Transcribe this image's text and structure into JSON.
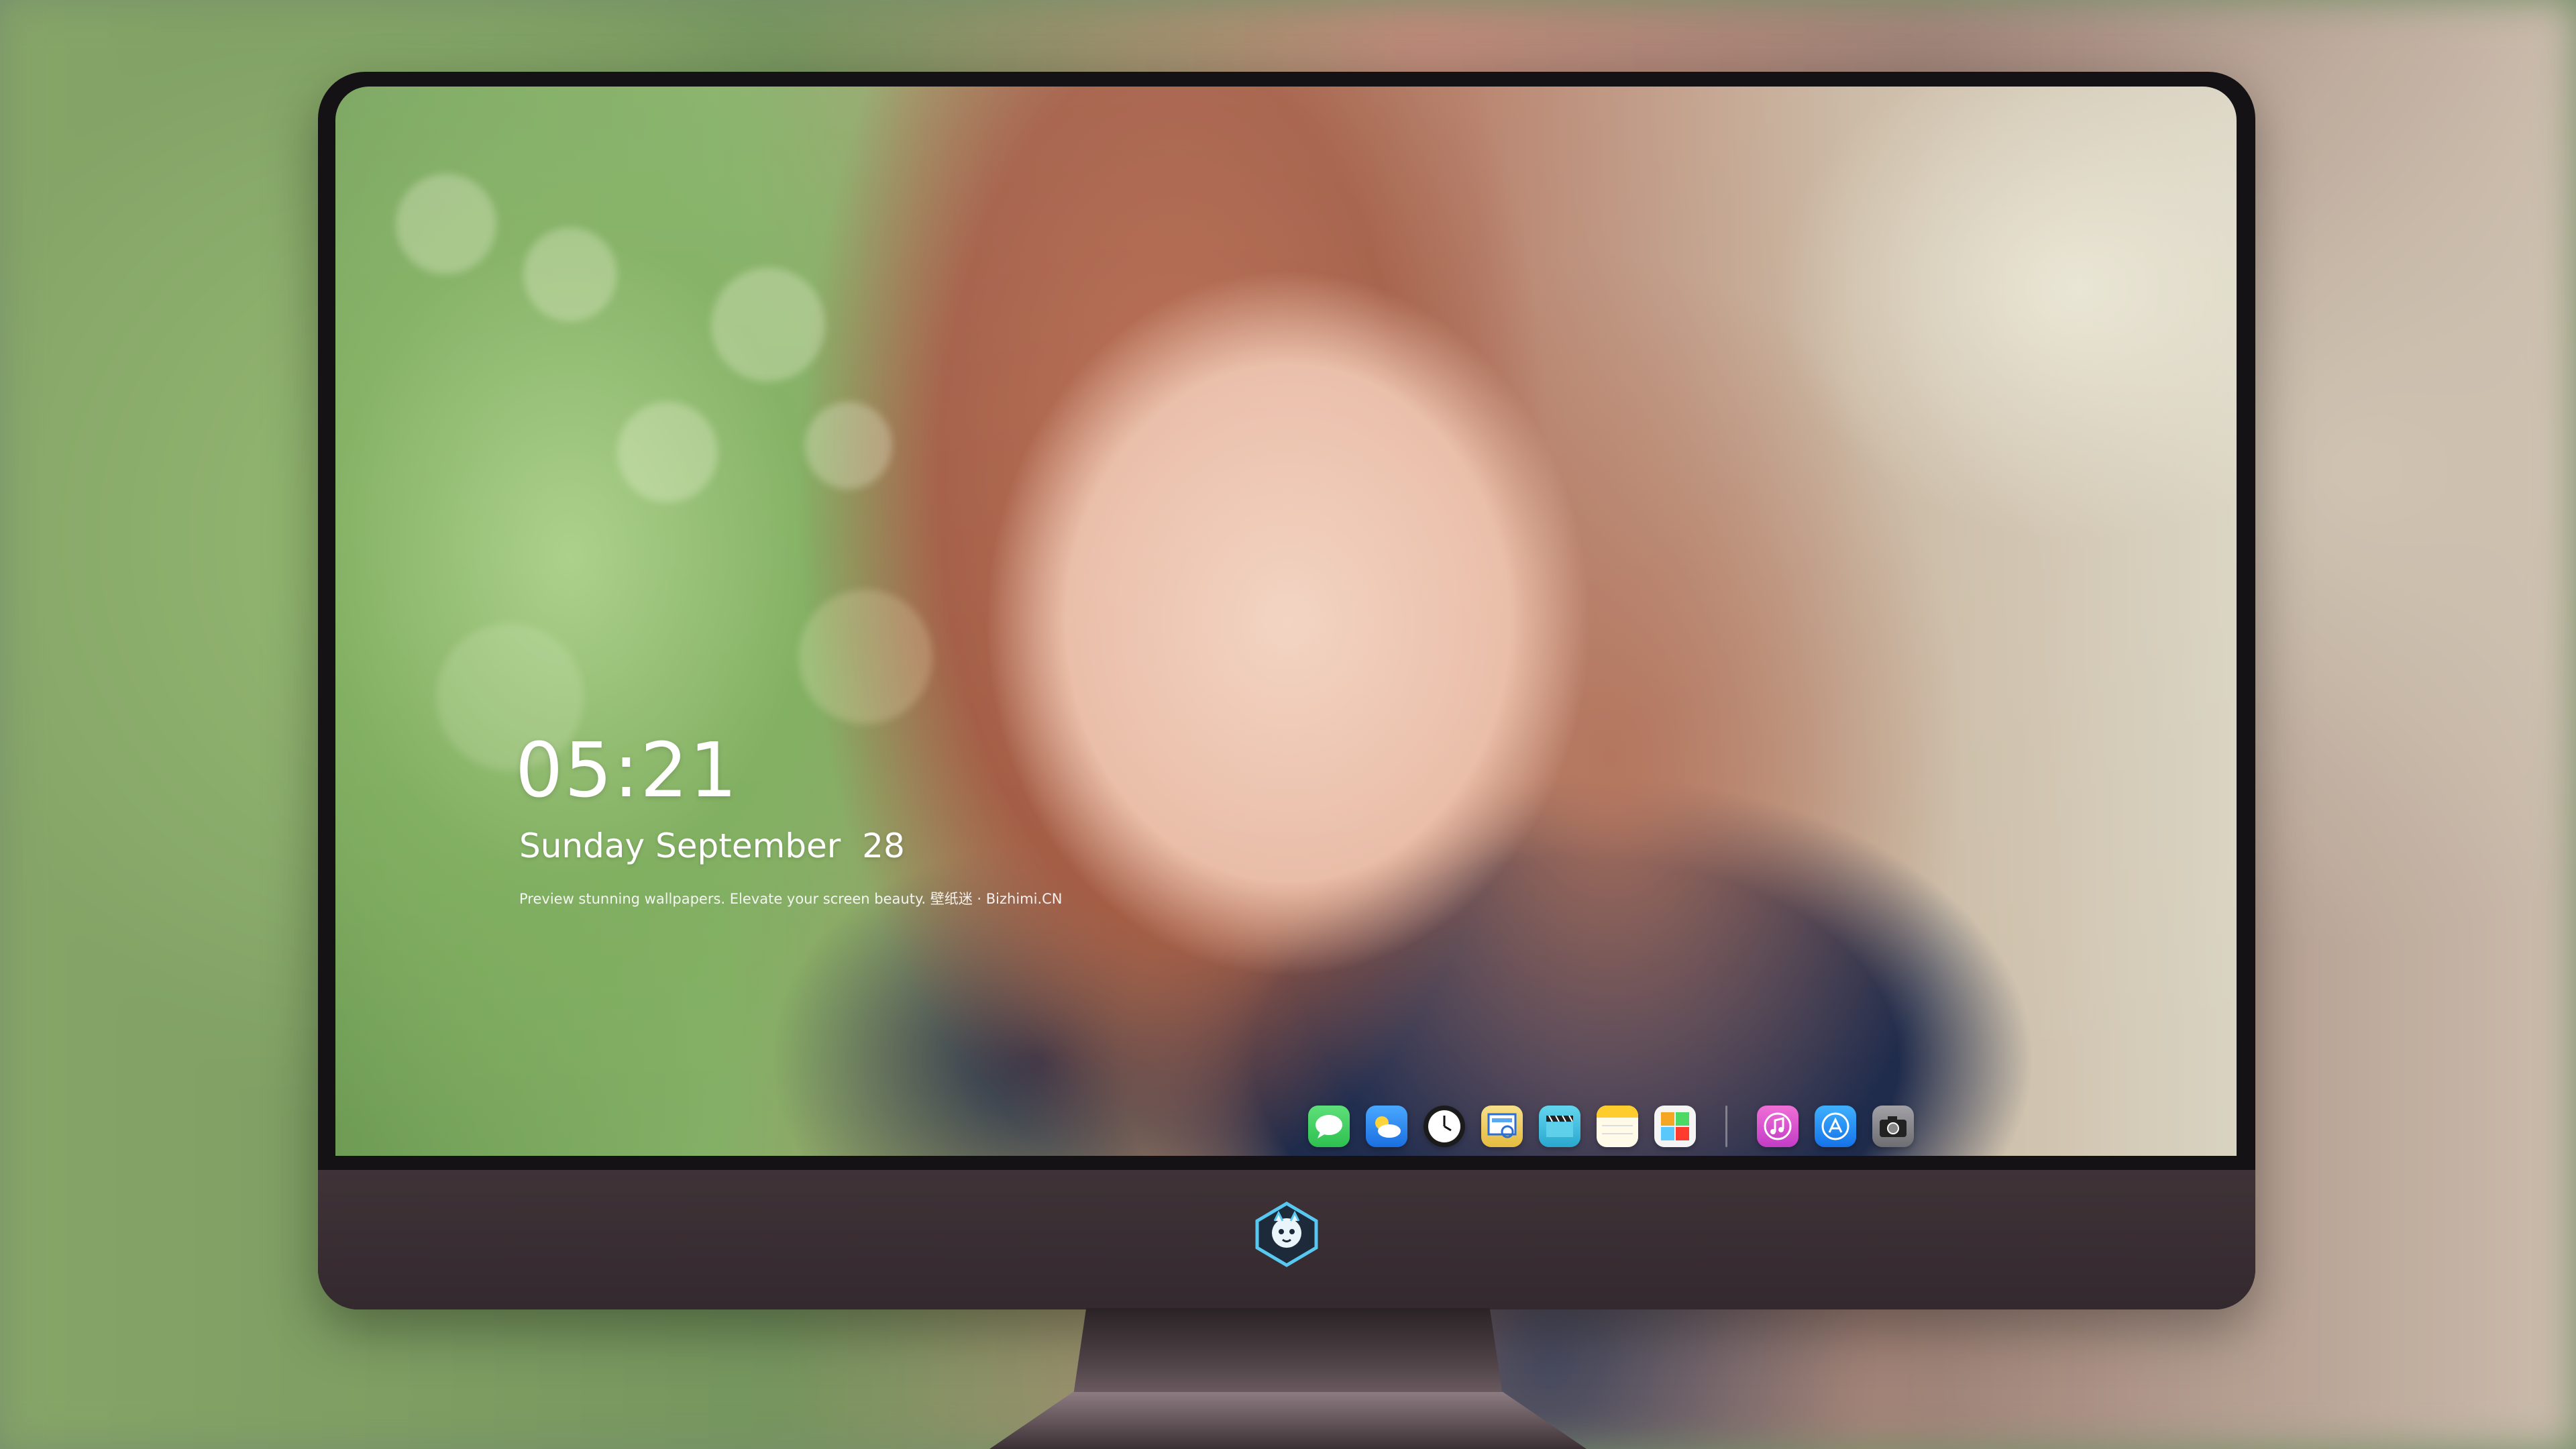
{
  "lock_screen": {
    "time": "05:21",
    "date": "Sunday September  28",
    "tagline": "Preview stunning wallpapers. Elevate your screen beauty. 壁纸迷 · Bizhimi.CN"
  },
  "dock": {
    "apps": [
      {
        "name": "messages-icon",
        "color": "#34c759"
      },
      {
        "name": "weather-icon",
        "color": "#2f8df5"
      },
      {
        "name": "clock-icon",
        "color": "#1b1b1b"
      },
      {
        "name": "preview-icon",
        "color": "#f2d36b"
      },
      {
        "name": "videos-icon",
        "color": "#2fb6d6"
      },
      {
        "name": "notes-icon",
        "color": "#ffd84a"
      },
      {
        "name": "photos-icon",
        "color": "#e8e8e8"
      },
      {
        "name": "itunes-icon",
        "color": "#e452c4"
      },
      {
        "name": "app-store-icon",
        "color": "#1e8cf0"
      },
      {
        "name": "camera-icon",
        "color": "#8e8e93"
      }
    ]
  },
  "brand": {
    "logo": "bizhimi-logo-icon"
  }
}
